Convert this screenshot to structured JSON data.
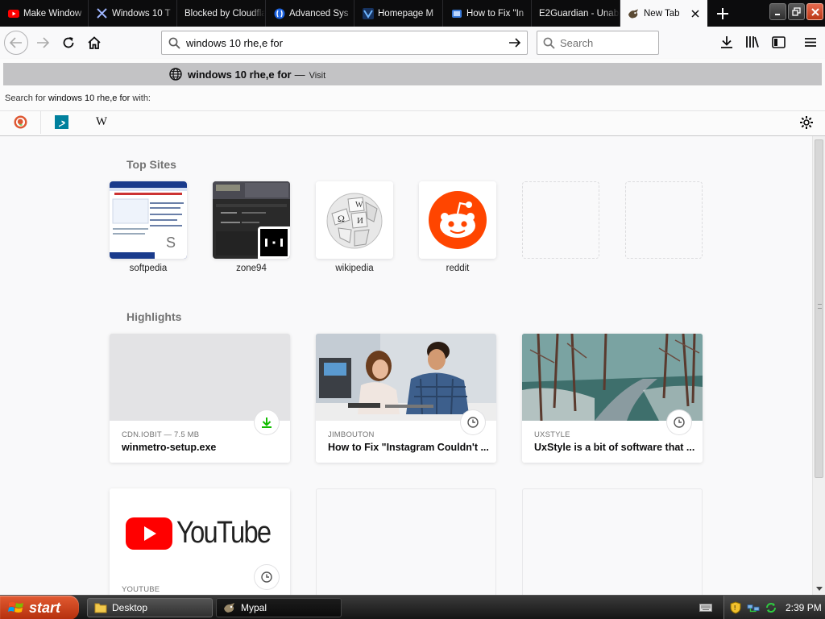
{
  "tabs": [
    {
      "title": "Make Window",
      "icon": "youtube-icon"
    },
    {
      "title": "Windows 10 T",
      "icon": "x-logo-icon"
    },
    {
      "title": "Blocked by Cloudfla",
      "icon": "blank-icon"
    },
    {
      "title": "Advanced Sys",
      "icon": "advanced-systemcare-icon"
    },
    {
      "title": "Homepage M",
      "icon": "homepage-icon"
    },
    {
      "title": "How to Fix \"In",
      "icon": "howto-icon"
    },
    {
      "title": "E2Guardian - Unab",
      "icon": "blank-icon"
    },
    {
      "title": "New Tab",
      "icon": "mypal-icon",
      "active": true
    }
  ],
  "navbar": {
    "url_value": "windows 10 rhe,e for",
    "search_placeholder": "Search"
  },
  "dropdown": {
    "query": "windows 10 rhe,e for",
    "separator": "—",
    "action": "Visit",
    "search_with_prefix": "Search for",
    "search_with_query": "windows 10 rhe,e for",
    "search_with_suffix": "with:",
    "engines": [
      "DuckDuckGo",
      "Bing",
      "Wikipedia"
    ]
  },
  "topsites": {
    "title": "Top Sites",
    "sites": [
      {
        "label": "softpedia",
        "badge": "S"
      },
      {
        "label": "zone94"
      },
      {
        "label": "wikipedia"
      },
      {
        "label": "reddit"
      },
      {
        "label": ""
      },
      {
        "label": ""
      }
    ]
  },
  "highlights": {
    "title": "Highlights",
    "cards": [
      {
        "context": "CDN.IOBIT — 7.5 MB",
        "title": "winmetro-setup.exe",
        "icon": "download-icon"
      },
      {
        "context": "JIMBOUTON",
        "title": "How to Fix \"Instagram Couldn't ...",
        "icon": "clock-icon"
      },
      {
        "context": "UXSTYLE",
        "title": "UxStyle is a bit of software that ...",
        "icon": "clock-icon"
      },
      {
        "context": "YOUTUBE",
        "title": "",
        "icon": "clock-icon",
        "logo_text": "YouTube"
      }
    ]
  },
  "taskbar": {
    "start_label": "start",
    "items": [
      {
        "label": "Desktop",
        "icon": "folder-icon"
      },
      {
        "label": "Mypal",
        "icon": "mypal-icon"
      }
    ],
    "clock": "2:39 PM"
  },
  "colors": {
    "tabstrip": "#0c0c0d",
    "accent_green": "#12bc00",
    "reddit": "#ff4500",
    "youtube_red": "#ff0000",
    "xp_start": "#c9421b"
  }
}
